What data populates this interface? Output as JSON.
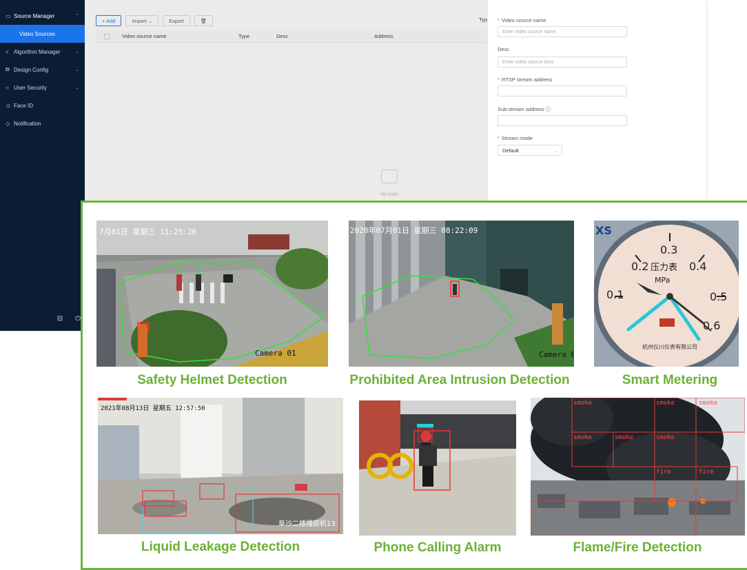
{
  "sidebar": {
    "items": [
      {
        "label": "Source Manager",
        "icon": "video-icon",
        "expanded": true
      },
      {
        "label": "Video Sources",
        "active": true
      },
      {
        "label": "Algorithm Manager",
        "icon": "share-icon"
      },
      {
        "label": "Design Config",
        "icon": "layers-icon"
      },
      {
        "label": "User Security",
        "icon": "shield-icon"
      },
      {
        "label": "Face ID",
        "icon": "face-icon"
      },
      {
        "label": "Notification",
        "icon": "bell-icon"
      }
    ],
    "footer_icons": [
      "monitor-icon",
      "power-icon"
    ]
  },
  "toolbar": {
    "add_label": "+ Add",
    "import_label": "Import",
    "export_label": "Export",
    "type_label_partial": "Typ"
  },
  "table": {
    "columns": [
      "Video source name",
      "Type",
      "Desc",
      "Address"
    ],
    "empty_text": "No Data"
  },
  "form": {
    "name_label": "Video source name",
    "name_placeholder": "Enter video source name",
    "desc_label": "Desc",
    "desc_placeholder": "Enter video source desc",
    "rtsp_label": "RTSP stream address",
    "sub_label": "Sub-stream address",
    "mode_label": "Stream mode",
    "mode_value": "Default"
  },
  "panel": {
    "accent": "#6cb43f",
    "captions": [
      "Safety Helmet Detection",
      "Prohibited Area Intrusion Detection",
      "Smart Metering",
      "Liquid Leakage Detection",
      "Phone Calling Alarm",
      "Flame/Fire Detection"
    ],
    "overlays": {
      "helmet_ts": "7月01日  星期三  11:25:26",
      "helmet_cam": "Camera 01",
      "intrusion_ts": "2020年07月01日  星期三  08:22:09",
      "intrusion_cam": "Camera 0",
      "meter_brand": "XS",
      "meter_unit": "压力表",
      "meter_mpa": "MPa",
      "meter_ticks": [
        "0.1",
        "0.2",
        "0.3",
        "0.4",
        "0.5",
        "0.6"
      ],
      "meter_maker": "杭州仪川仪表有限公司",
      "leak_ts": "2021年08月13日  星期五  12:57:50",
      "leak_cam": "阜沙二楼播痰机13",
      "smoke_label": "smoke",
      "fire_label": "fire"
    }
  }
}
